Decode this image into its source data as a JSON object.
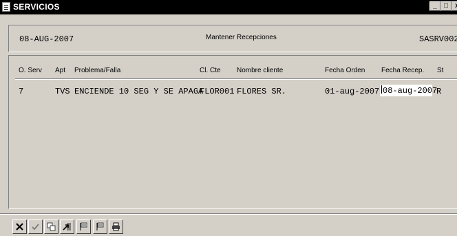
{
  "window": {
    "title": "SERVICIOS",
    "minimize_label": "_",
    "maximize_label": "□",
    "close_label": "x"
  },
  "header": {
    "date": "08-AUG-2007",
    "screen_title": "Mantener Recepciones",
    "screen_code": "SASRV002"
  },
  "table": {
    "columns": [
      "O. Serv",
      "Apt",
      "Problema/Falla",
      "Cl. Cte",
      "Nombre cliente",
      "Fecha Orden",
      "Fecha Recep.",
      "St"
    ],
    "rows": [
      {
        "orden_servicio": "7",
        "aparato": "TVS",
        "problema": "ENCIENDE 10 SEG Y SE APAGA",
        "clave_cliente": "FLOR001",
        "nombre_cliente": "FLORES SR.",
        "fecha_orden": "01-aug-2007",
        "fecha_recepcion": "08-aug-2007",
        "status": "R"
      }
    ]
  },
  "toolbar": {
    "buttons": [
      "close-x-icon",
      "check-icon",
      "copy-icon",
      "exit-arrow-icon",
      "flag-first-icon",
      "flag-next-icon",
      "printer-icon"
    ]
  }
}
